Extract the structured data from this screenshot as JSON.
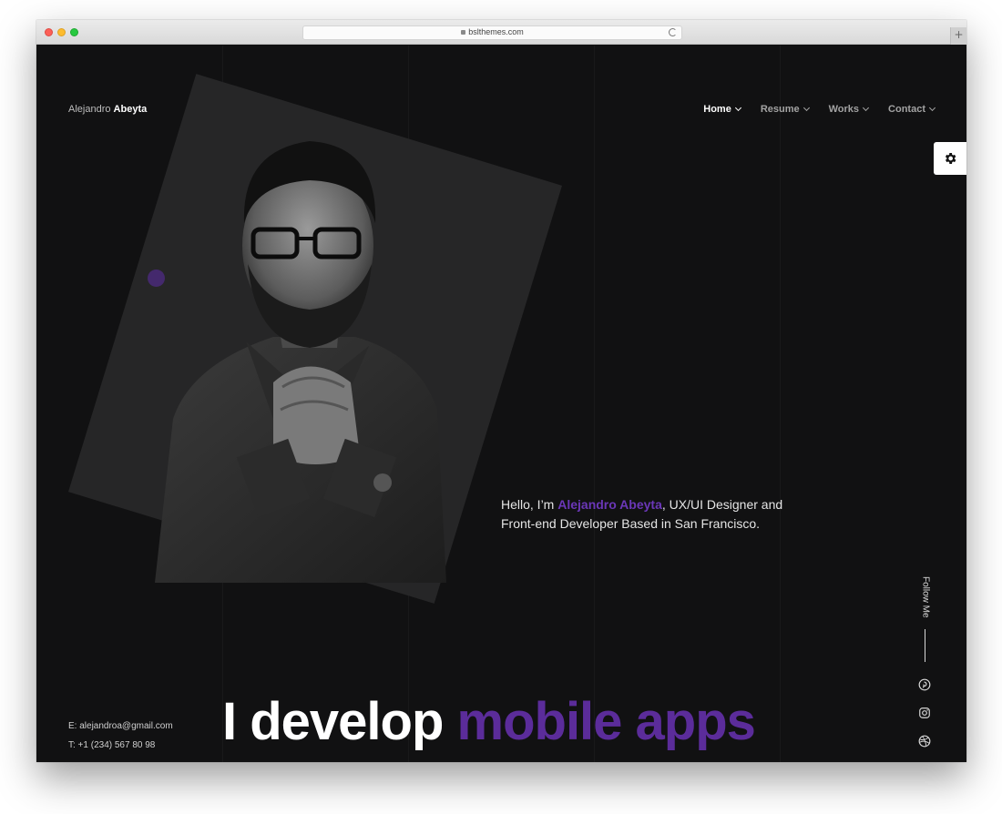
{
  "browser": {
    "url": "bslthemes.com",
    "new_tab": "+"
  },
  "site": {
    "logo_first": "Alejandro",
    "logo_last": "Abeyta",
    "nav": [
      {
        "label": "Home",
        "active": true
      },
      {
        "label": "Resume",
        "active": false
      },
      {
        "label": "Works",
        "active": false
      },
      {
        "label": "Contact",
        "active": false
      }
    ],
    "intro": {
      "prefix": "Hello, I’m ",
      "name": "Alejandro Abeyta",
      "suffix": ", UX/UI Designer and Front-end Developer Based in San Francisco."
    },
    "contact": {
      "email": "E: alejandroa@gmail.com",
      "phone": "T: +1 (234) 567 80 98"
    },
    "headline": {
      "white": "I develop ",
      "purple": "mobile apps"
    },
    "follow_label": "Follow Me",
    "social_icons": [
      "pinterest-icon",
      "instagram-icon",
      "dribbble-icon"
    ],
    "colors": {
      "accent": "#5b2c9a",
      "background": "#111112",
      "panel": "#262627"
    }
  }
}
